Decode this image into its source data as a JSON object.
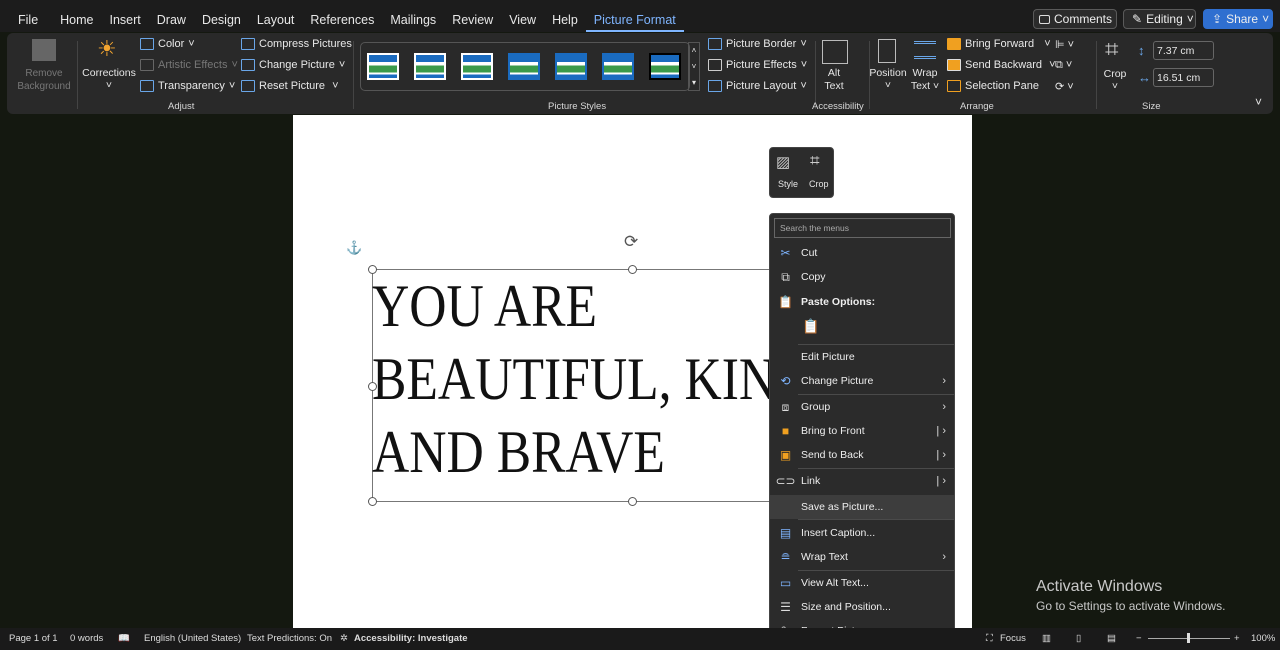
{
  "tabs": [
    "File",
    "Home",
    "Insert",
    "Draw",
    "Design",
    "Layout",
    "References",
    "Mailings",
    "Review",
    "View",
    "Help",
    "Picture Format"
  ],
  "active_tab": "Picture Format",
  "top_buttons": {
    "comments": "Comments",
    "editing": "Editing",
    "share": "Share"
  },
  "ribbon": {
    "remove_bg": [
      "Remove",
      "Background"
    ],
    "corrections": "Corrections",
    "color": "Color",
    "artistic": "Artistic Effects",
    "transparency": "Transparency",
    "compress": "Compress Pictures",
    "change": "Change Picture",
    "reset": "Reset Picture",
    "adjust_label": "Adjust",
    "styles_label": "Picture Styles",
    "border": "Picture Border",
    "effects": "Picture Effects",
    "layout": "Picture Layout",
    "alt": [
      "Alt",
      "Text"
    ],
    "access_label": "Accessibility",
    "position": "Position",
    "wrap": [
      "Wrap",
      "Text"
    ],
    "bring_forward": "Bring Forward",
    "send_backward": "Send Backward",
    "selection_pane": "Selection Pane",
    "arrange_label": "Arrange",
    "crop": "Crop",
    "height": "7.37 cm",
    "width": "16.51 cm",
    "size_label": "Size"
  },
  "document": {
    "lines": [
      "YOU ARE",
      "BEAUTIFUL, KIND",
      "AND BRAVE"
    ]
  },
  "mini_toolbar": {
    "style": "Style",
    "crop": "Crop"
  },
  "context_menu": {
    "search_placeholder": "Search the menus",
    "items": [
      "Cut",
      "Copy",
      "Paste Options:",
      "Edit Picture",
      "Change Picture",
      "Group",
      "Bring to Front",
      "Send to Back",
      "Link",
      "Save as Picture...",
      "Insert Caption...",
      "Wrap Text",
      "View Alt Text...",
      "Size and Position...",
      "Format Picture..."
    ]
  },
  "status": {
    "page": "Page 1 of 1",
    "words": "0 words",
    "language": "English (United States)",
    "predictions": "Text Predictions: On",
    "accessibility": "Accessibility: Investigate",
    "focus": "Focus",
    "zoom": "100%"
  },
  "watermark": {
    "title": "Activate Windows",
    "sub": "Go to Settings to activate Windows."
  }
}
